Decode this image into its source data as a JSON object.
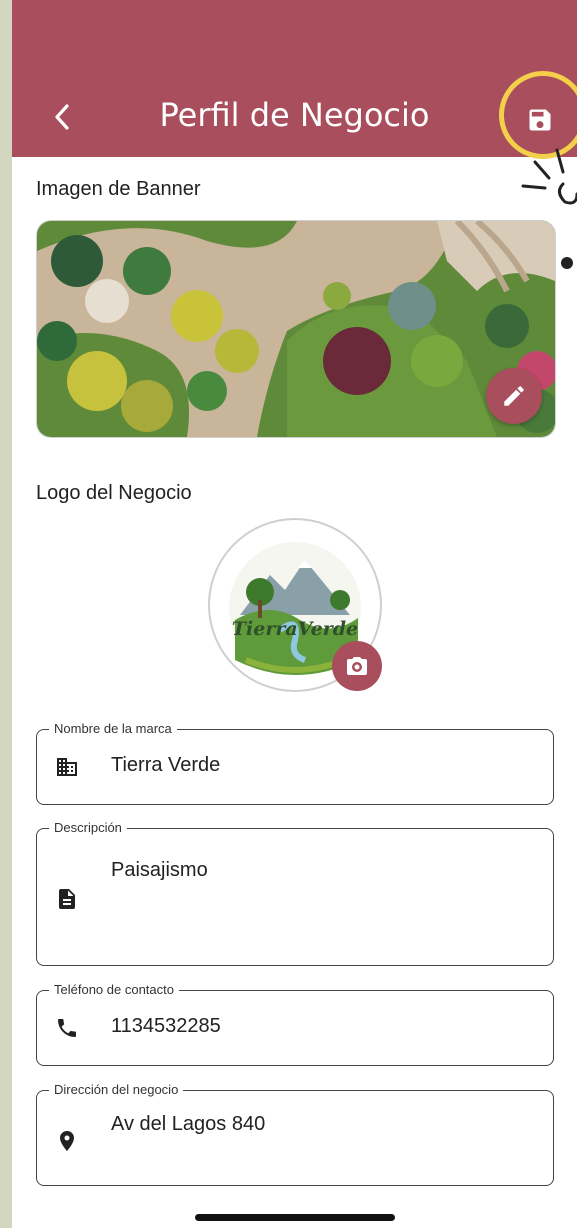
{
  "app_bar": {
    "title": "Perfil de Negocio",
    "back_icon": "chevron-left-icon",
    "save_icon": "save-icon",
    "color": "#a84e5c"
  },
  "banner": {
    "label": "Imagen de Banner",
    "edit_icon": "pencil-icon"
  },
  "logo": {
    "label": "Logo del Negocio",
    "brand_text": "TierraVerde",
    "camera_icon": "camera-icon"
  },
  "fields": {
    "brand_name": {
      "legend": "Nombre de la marca",
      "value": "Tierra Verde",
      "icon": "building-icon"
    },
    "description": {
      "legend": "Descripción",
      "value": "Paisajismo",
      "icon": "document-icon"
    },
    "phone": {
      "legend": "Teléfono de contacto",
      "value": "1134532285",
      "icon": "phone-icon"
    },
    "address": {
      "legend": "Dirección del negocio",
      "value": "Av del Lagos 840",
      "icon": "location-pin-icon"
    }
  },
  "colors": {
    "accent": "#a84e5c",
    "highlight": "#f3cf4a",
    "page_background": "#d3d7bf"
  }
}
